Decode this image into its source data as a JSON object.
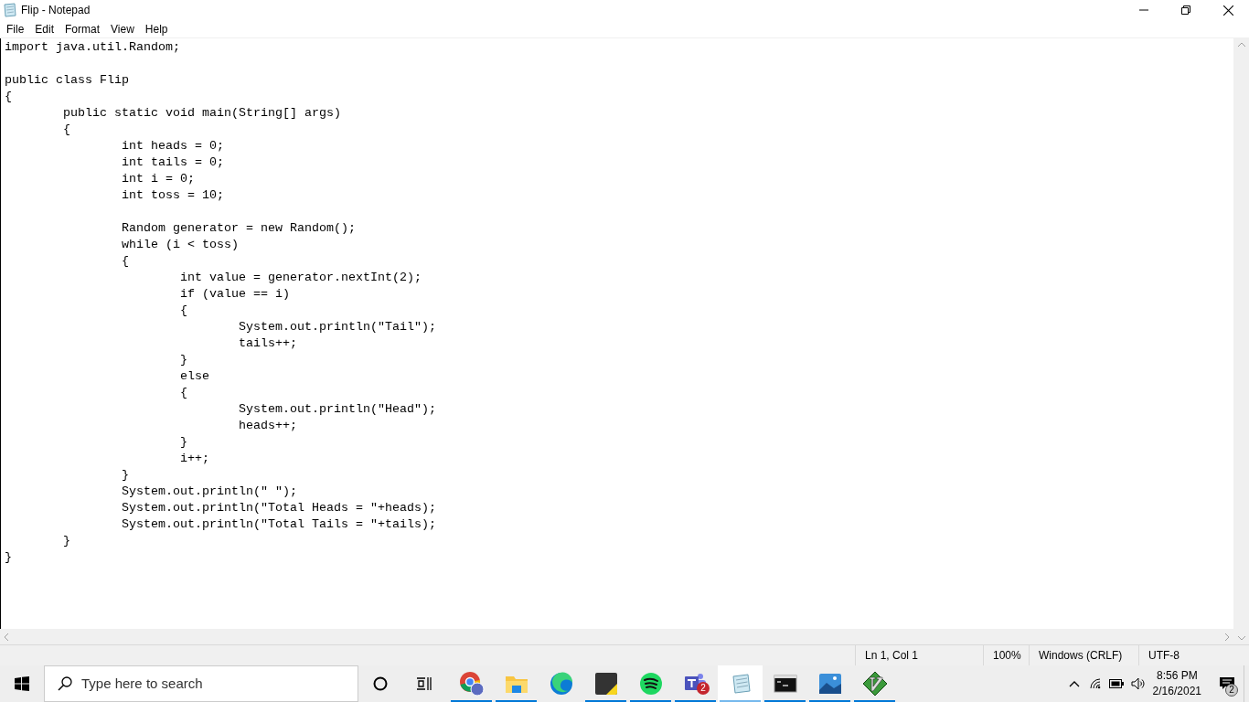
{
  "window": {
    "title": "Flip - Notepad"
  },
  "menu": [
    "File",
    "Edit",
    "Format",
    "View",
    "Help"
  ],
  "editor": {
    "text": "import java.util.Random;\n\npublic class Flip\n{\n\tpublic static void main(String[] args)\n\t{\n\t\tint heads = 0;\n\t\tint tails = 0;\n\t\tint i = 0;\n\t\tint toss = 10;\n\n\t\tRandom generator = new Random();\n\t\twhile (i < toss)\n\t\t{\n\t\t\tint value = generator.nextInt(2);\n\t\t\tif (value == i)\n\t\t\t{\n\t\t\t\tSystem.out.println(\"Tail\");\n\t\t\t\ttails++;\n\t\t\t}\n\t\t\telse\n\t\t\t{\n\t\t\t\tSystem.out.println(\"Head\");\n\t\t\t\theads++;\n\t\t\t}\n\t\t\ti++;\n\t\t}\n\t\tSystem.out.println(\" \");\n\t\tSystem.out.println(\"Total Heads = \"+heads);\n\t\tSystem.out.println(\"Total Tails = \"+tails);\n\t}\n}"
  },
  "status_bar": [
    "Ln 1, Col 1",
    "100%",
    "Windows (CRLF)",
    "UTF-8"
  ],
  "taskbar": {
    "search_placeholder": "Type here to search",
    "apps": [
      {
        "kind": "chrome",
        "running": true,
        "active": false
      },
      {
        "kind": "folder",
        "running": true,
        "active": false
      },
      {
        "kind": "edge",
        "running": false,
        "active": false
      },
      {
        "kind": "sticky",
        "running": true,
        "active": false
      },
      {
        "kind": "spotify",
        "running": true,
        "active": false
      },
      {
        "kind": "teams",
        "running": true,
        "active": false,
        "badge": "2"
      },
      {
        "kind": "notepad",
        "running": true,
        "active": true
      },
      {
        "kind": "terminal",
        "running": true,
        "active": false
      },
      {
        "kind": "photos",
        "running": true,
        "active": false
      },
      {
        "kind": "vim",
        "running": true,
        "active": false
      }
    ],
    "time": "8:56 PM",
    "date": "2/16/2021",
    "notifications": "2"
  }
}
